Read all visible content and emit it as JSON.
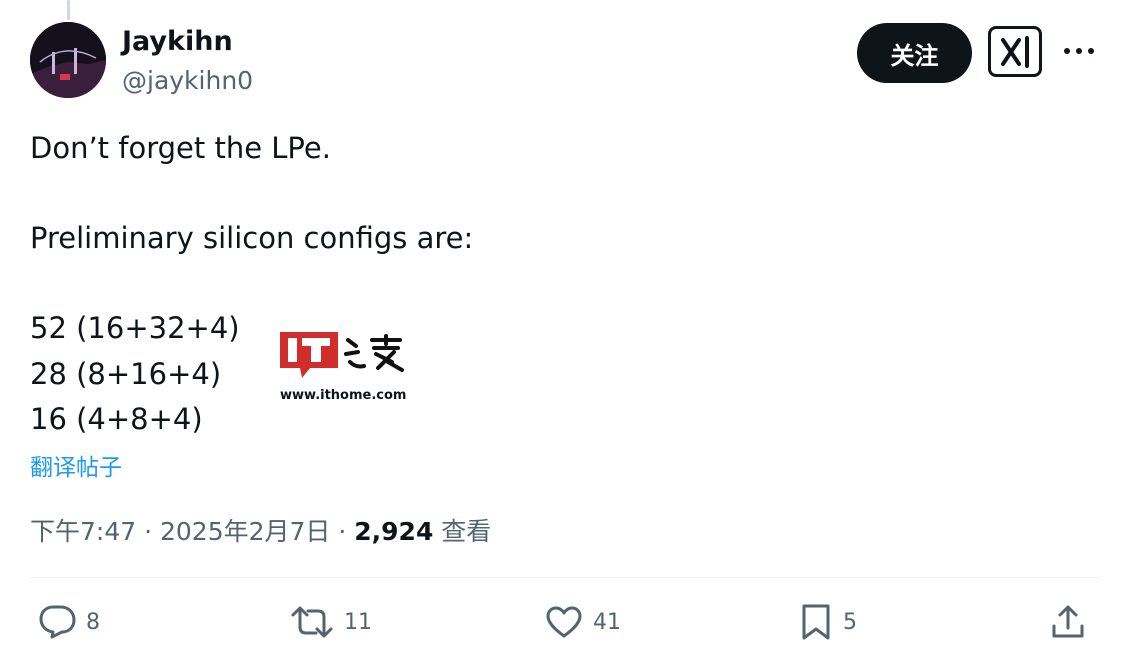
{
  "author": {
    "name": "Jaykihn",
    "handle": "@jaykihn0"
  },
  "header": {
    "follow_label": "关注",
    "grok_icon": "grok-icon",
    "more_icon": "more-icon"
  },
  "tweet": {
    "lines": [
      "Don’t forget the LPe.",
      "Preliminary silicon configs are:",
      "52 (16+32+4)",
      "28 (8+16+4)",
      "16 (4+8+4)"
    ],
    "translate_label": "翻译帖子"
  },
  "watermark": {
    "logo_text": "IT之家",
    "url": "www.ithome.com"
  },
  "meta": {
    "time": "下午7:47",
    "separator": " · ",
    "date": "2025年2月7日",
    "views_count": "2,924",
    "views_label": "查看"
  },
  "actions": {
    "replies": {
      "icon": "reply-icon",
      "count": "8"
    },
    "reposts": {
      "icon": "repost-icon",
      "count": "11"
    },
    "likes": {
      "icon": "heart-icon",
      "count": "41"
    },
    "bookmarks": {
      "icon": "bookmark-icon",
      "count": "5"
    },
    "share": {
      "icon": "share-icon"
    }
  },
  "colors": {
    "text_primary": "#0f1419",
    "text_secondary": "#536471",
    "link": "#1d9bf0",
    "watermark_red": "#d22d2d"
  }
}
